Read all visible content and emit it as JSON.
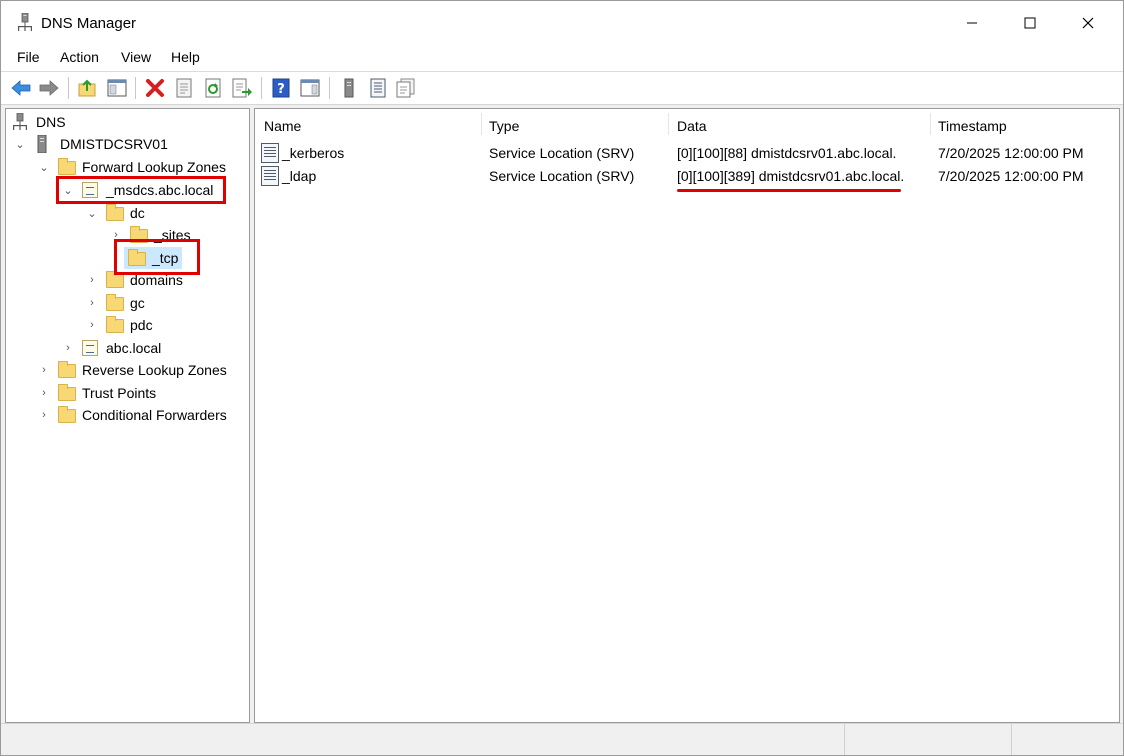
{
  "window": {
    "title": "DNS Manager"
  },
  "menu": [
    "File",
    "Action",
    "View",
    "Help"
  ],
  "toolbar_icons": [
    "back-arrow-icon",
    "forward-arrow-icon",
    "up-folder-icon",
    "show-hide-tree-icon",
    "delete-icon",
    "properties-icon",
    "refresh-icon",
    "export-list-icon",
    "help-icon",
    "show-hide-action-pane-icon",
    "server-icon",
    "list-view-icon",
    "details-view-icon"
  ],
  "tree": {
    "root": "DNS",
    "server": "DMISTDCSRV01",
    "forward_zones": "Forward Lookup Zones",
    "msdcs_zone": "_msdcs.abc.local",
    "dc": "dc",
    "sites": "_sites",
    "tcp": "_tcp",
    "domains": "domains",
    "gc": "gc",
    "pdc": "pdc",
    "abc_local": "abc.local",
    "reverse_zones": "Reverse Lookup Zones",
    "trust_points": "Trust Points",
    "conditional_forwarders": "Conditional Forwarders"
  },
  "columns": {
    "name": "Name",
    "type": "Type",
    "data": "Data",
    "timestamp": "Timestamp"
  },
  "records": [
    {
      "name": "_kerberos",
      "type": "Service Location (SRV)",
      "data": "[0][100][88] dmistdcsrv01.abc.local.",
      "timestamp": "7/20/2025 12:00:00 PM"
    },
    {
      "name": "_ldap",
      "type": "Service Location (SRV)",
      "data": "[0][100][389] dmistdcsrv01.abc.local.",
      "timestamp": "7/20/2025 12:00:00 PM"
    }
  ],
  "colors": {
    "highlight": "#e00000",
    "selection": "#cce8ff",
    "folder": "#f8d775"
  }
}
